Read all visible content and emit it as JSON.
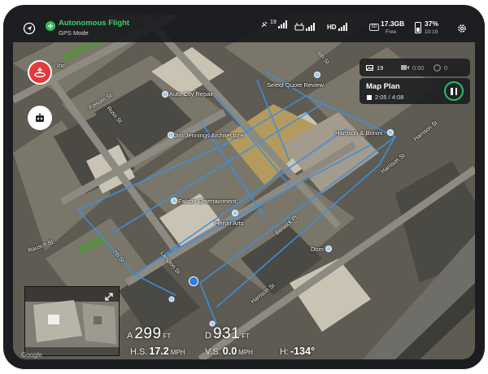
{
  "header": {
    "flight_title": "Autonomous Flight",
    "flight_mode": "GPS Mode",
    "satellite_count": "19",
    "hd_label": "HD",
    "storage_value": "17.3GB",
    "storage_label": "Free",
    "storage_badge": "SD",
    "battery_percent": "37%",
    "battery_time": "10:19"
  },
  "mission": {
    "photo_count": "19",
    "video_time": "0:00",
    "other_count": "0",
    "plan_title": "Map Plan",
    "plan_time": "2:05 / 4:08"
  },
  "map_labels": {
    "auto_city_repair": "Auto City Repair",
    "select_quote_review": "Select Quote Review",
    "jim_jennings": "Jim Jennings Architecture",
    "harrison_bonini": "Harrison & Bonini",
    "falcon": "Falcon Entertainment",
    "heron_arts": "Heron Arts",
    "dom": "Dom",
    "inc": "Inc",
    "harrison_st_1": "Harrison St",
    "harrison_st_2": "Harrison St",
    "harrison_st_3": "Harrison St",
    "folsom_st": "Folsom St",
    "russ_st": "Russ St",
    "berwick_pl": "Berwick Pl",
    "seventh_st": "7th St",
    "langton_st": "Langton St",
    "rausch_st": "Rausch St",
    "sixth_st": "6th St",
    "google": "Google"
  },
  "telemetry": {
    "altitude_label": "A",
    "altitude_value": "299",
    "altitude_unit": "FT",
    "distance_label": "D",
    "distance_value": "931",
    "distance_unit": "FT",
    "hs_label": "H.S.",
    "hs_value": "17.2",
    "hs_unit": "MPH",
    "vs_label": "V.S.",
    "vs_value": "0.0",
    "vs_unit": "MPH",
    "heading_label": "H:",
    "heading_value": "-134°"
  },
  "colors": {
    "accent_green": "#2bbf5a",
    "record_red": "#e23b3b",
    "flight_path_blue": "#3d8fe0"
  }
}
